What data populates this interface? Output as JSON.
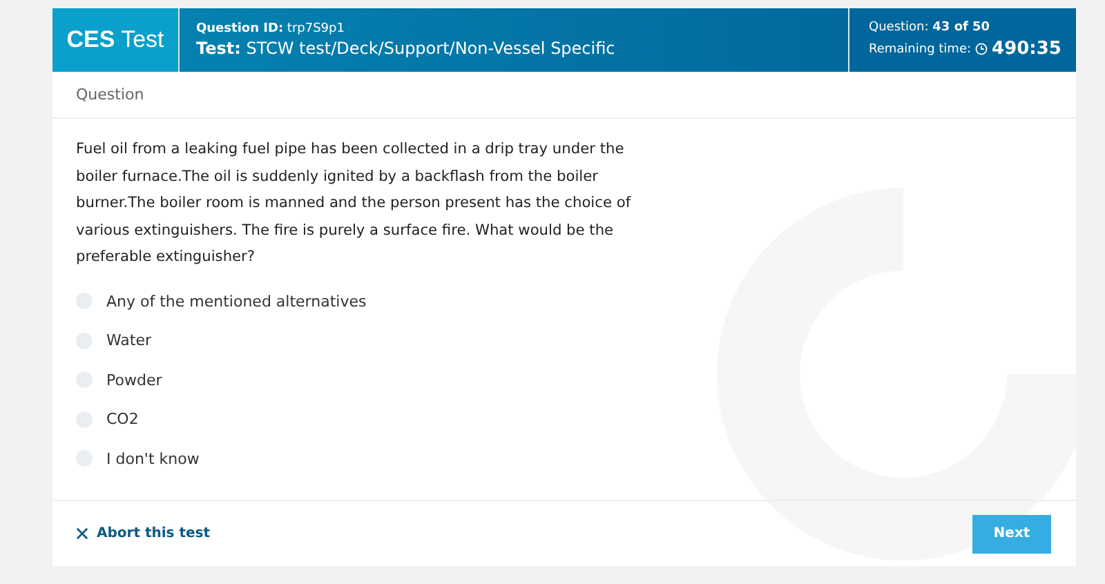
{
  "header": {
    "logo": "**CES** Test",
    "question_id": "**Question ID:** trp7S9p1",
    "test": "**Test:** STCW test/Deck/Support/Non-Vessel Specific",
    "progress": "Question: **43 of 50**",
    "remaining_label": "Remaining time:",
    "remaining_time": "490:35"
  },
  "section_title": "Question",
  "question": "Fuel oil from a leaking fuel pipe has been collected in a drip tray under the boiler furnace.The oil is suddenly ignited by a backflash from the boiler burner.The boiler room is manned and the person present has the choice of various extinguishers. The fire is purely a surface fire. What would be the preferable extinguisher?",
  "options": [
    {
      "label": "Any of the mentioned alternatives",
      "selected": false
    },
    {
      "label": "Water",
      "selected": false
    },
    {
      "label": "Powder",
      "selected": false
    },
    {
      "label": "CO2",
      "selected": false
    },
    {
      "label": "I don't know",
      "selected": false
    }
  ],
  "footer": {
    "abort": "Abort this test",
    "next": "Next"
  }
}
